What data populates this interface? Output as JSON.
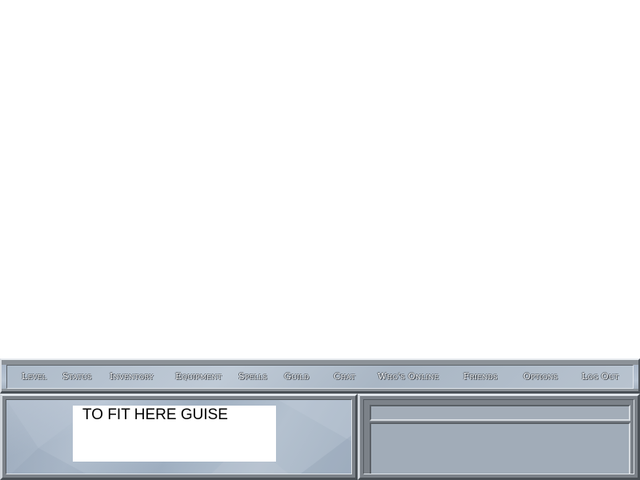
{
  "menu": {
    "items": [
      {
        "label": "Level"
      },
      {
        "label": "Status"
      },
      {
        "label": "Inventory"
      },
      {
        "label": "Equipment"
      },
      {
        "label": "Spells"
      },
      {
        "label": "Guild"
      },
      {
        "label": "Chat"
      },
      {
        "label": "Who's Online"
      },
      {
        "label": "Friends"
      },
      {
        "label": "Options"
      },
      {
        "label": "Log Out"
      }
    ]
  },
  "left_panel": {
    "note_text": "TO FIT HERE GUISE"
  },
  "right_panel": {
    "chat_input_value": "",
    "chat_log_text": ""
  },
  "colors": {
    "menu_text": "#f4f6f9",
    "panel_stone": "#7c8289",
    "chat_field": "#a3adb8"
  }
}
